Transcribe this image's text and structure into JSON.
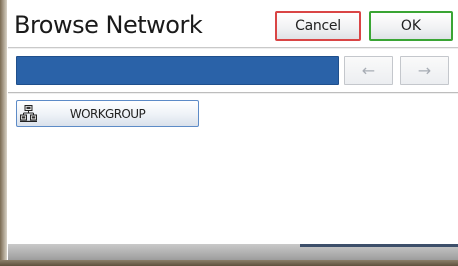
{
  "dialog": {
    "title": "Browse Network",
    "cancel_label": "Cancel",
    "ok_label": "OK"
  },
  "navigation": {
    "back_icon": "arrow-left-icon",
    "back_glyph": "←",
    "forward_icon": "arrow-right-icon",
    "forward_glyph": "→"
  },
  "network_items": [
    {
      "label": "WORKGROUP",
      "icon": "network-group-icon"
    }
  ],
  "colors": {
    "path_bar": "#2a62a8",
    "cancel_border": "#d94545",
    "ok_border": "#3aa534",
    "item_border": "#5d8bc7"
  }
}
